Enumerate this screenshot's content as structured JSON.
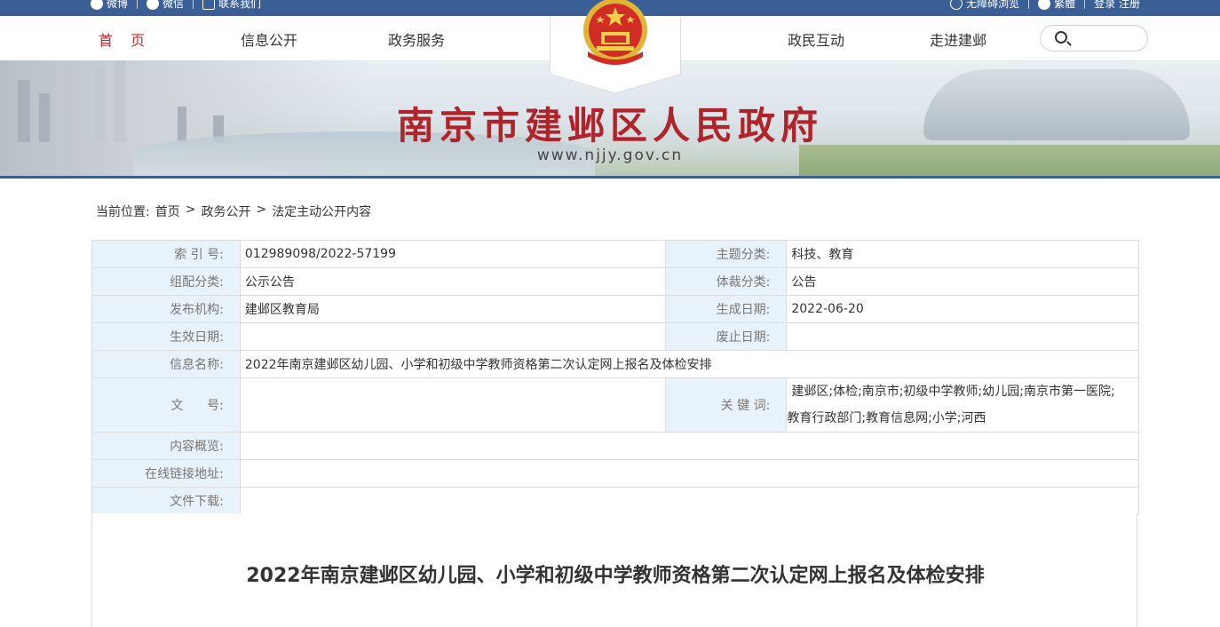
{
  "topbar": {
    "left_items": [
      {
        "icon": "weibo-icon",
        "label": "微博"
      },
      {
        "icon": "wechat-icon",
        "label": "微信"
      },
      {
        "icon": "phone-icon",
        "label": "联系我们"
      }
    ],
    "right_items": [
      {
        "icon": "accessibility-icon",
        "label": "无障碍浏览"
      },
      {
        "icon": "user-icon",
        "label": "繁體"
      },
      {
        "label": "登录 注册"
      }
    ]
  },
  "nav": {
    "items": [
      "首页",
      "信息公开",
      "政务服务",
      "政民互动",
      "走进建邺"
    ]
  },
  "search": {
    "placeholder": ""
  },
  "banner": {
    "title": "南京市建邺区人民政府",
    "url": "www.njjy.gov.cn"
  },
  "breadcrumb": {
    "label": "当前位置:",
    "items": [
      "首页",
      "政务公开",
      "法定主动公开内容"
    ],
    "separator": ">"
  },
  "info": {
    "index_no_label": "索 引 号:",
    "index_no": "012989098/2022-57199",
    "theme_label": "主题分类:",
    "theme": "科技、教育",
    "group_label": "组配分类:",
    "group": "公示公告",
    "genre_label": "体裁分类:",
    "genre": "公告",
    "publisher_label": "发布机构:",
    "publisher": "建邺区教育局",
    "created_label": "生成日期:",
    "created": "2022-06-20",
    "effective_label": "生效日期:",
    "effective": "",
    "abolished_label": "废止日期:",
    "abolished": "",
    "name_label": "信息名称:",
    "name": "2022年南京建邺区幼儿园、小学和初级中学教师资格第二次认定网上报名及体检安排",
    "doc_no_label": "文      号:",
    "doc_no": "",
    "keywords_label": "关 键 词:",
    "keywords_line1": "建邺区;体检;南京市;初级中学教师;幼儿园;南京市第一医院;",
    "keywords_line2": "教育行政部门;教育信息网;小学;河西",
    "summary_label": "内容概览:",
    "summary": "",
    "link_label": "在线链接地址:",
    "link": "",
    "download_label": "文件下载:",
    "download": ""
  },
  "article": {
    "title": "2022年南京建邺区幼儿园、小学和初级中学教师资格第二次认定网上报名及体检安排"
  },
  "colors": {
    "topbar": "#3a5f95",
    "accent_red": "#c0292c",
    "label_bg": "#e8f2fb"
  }
}
